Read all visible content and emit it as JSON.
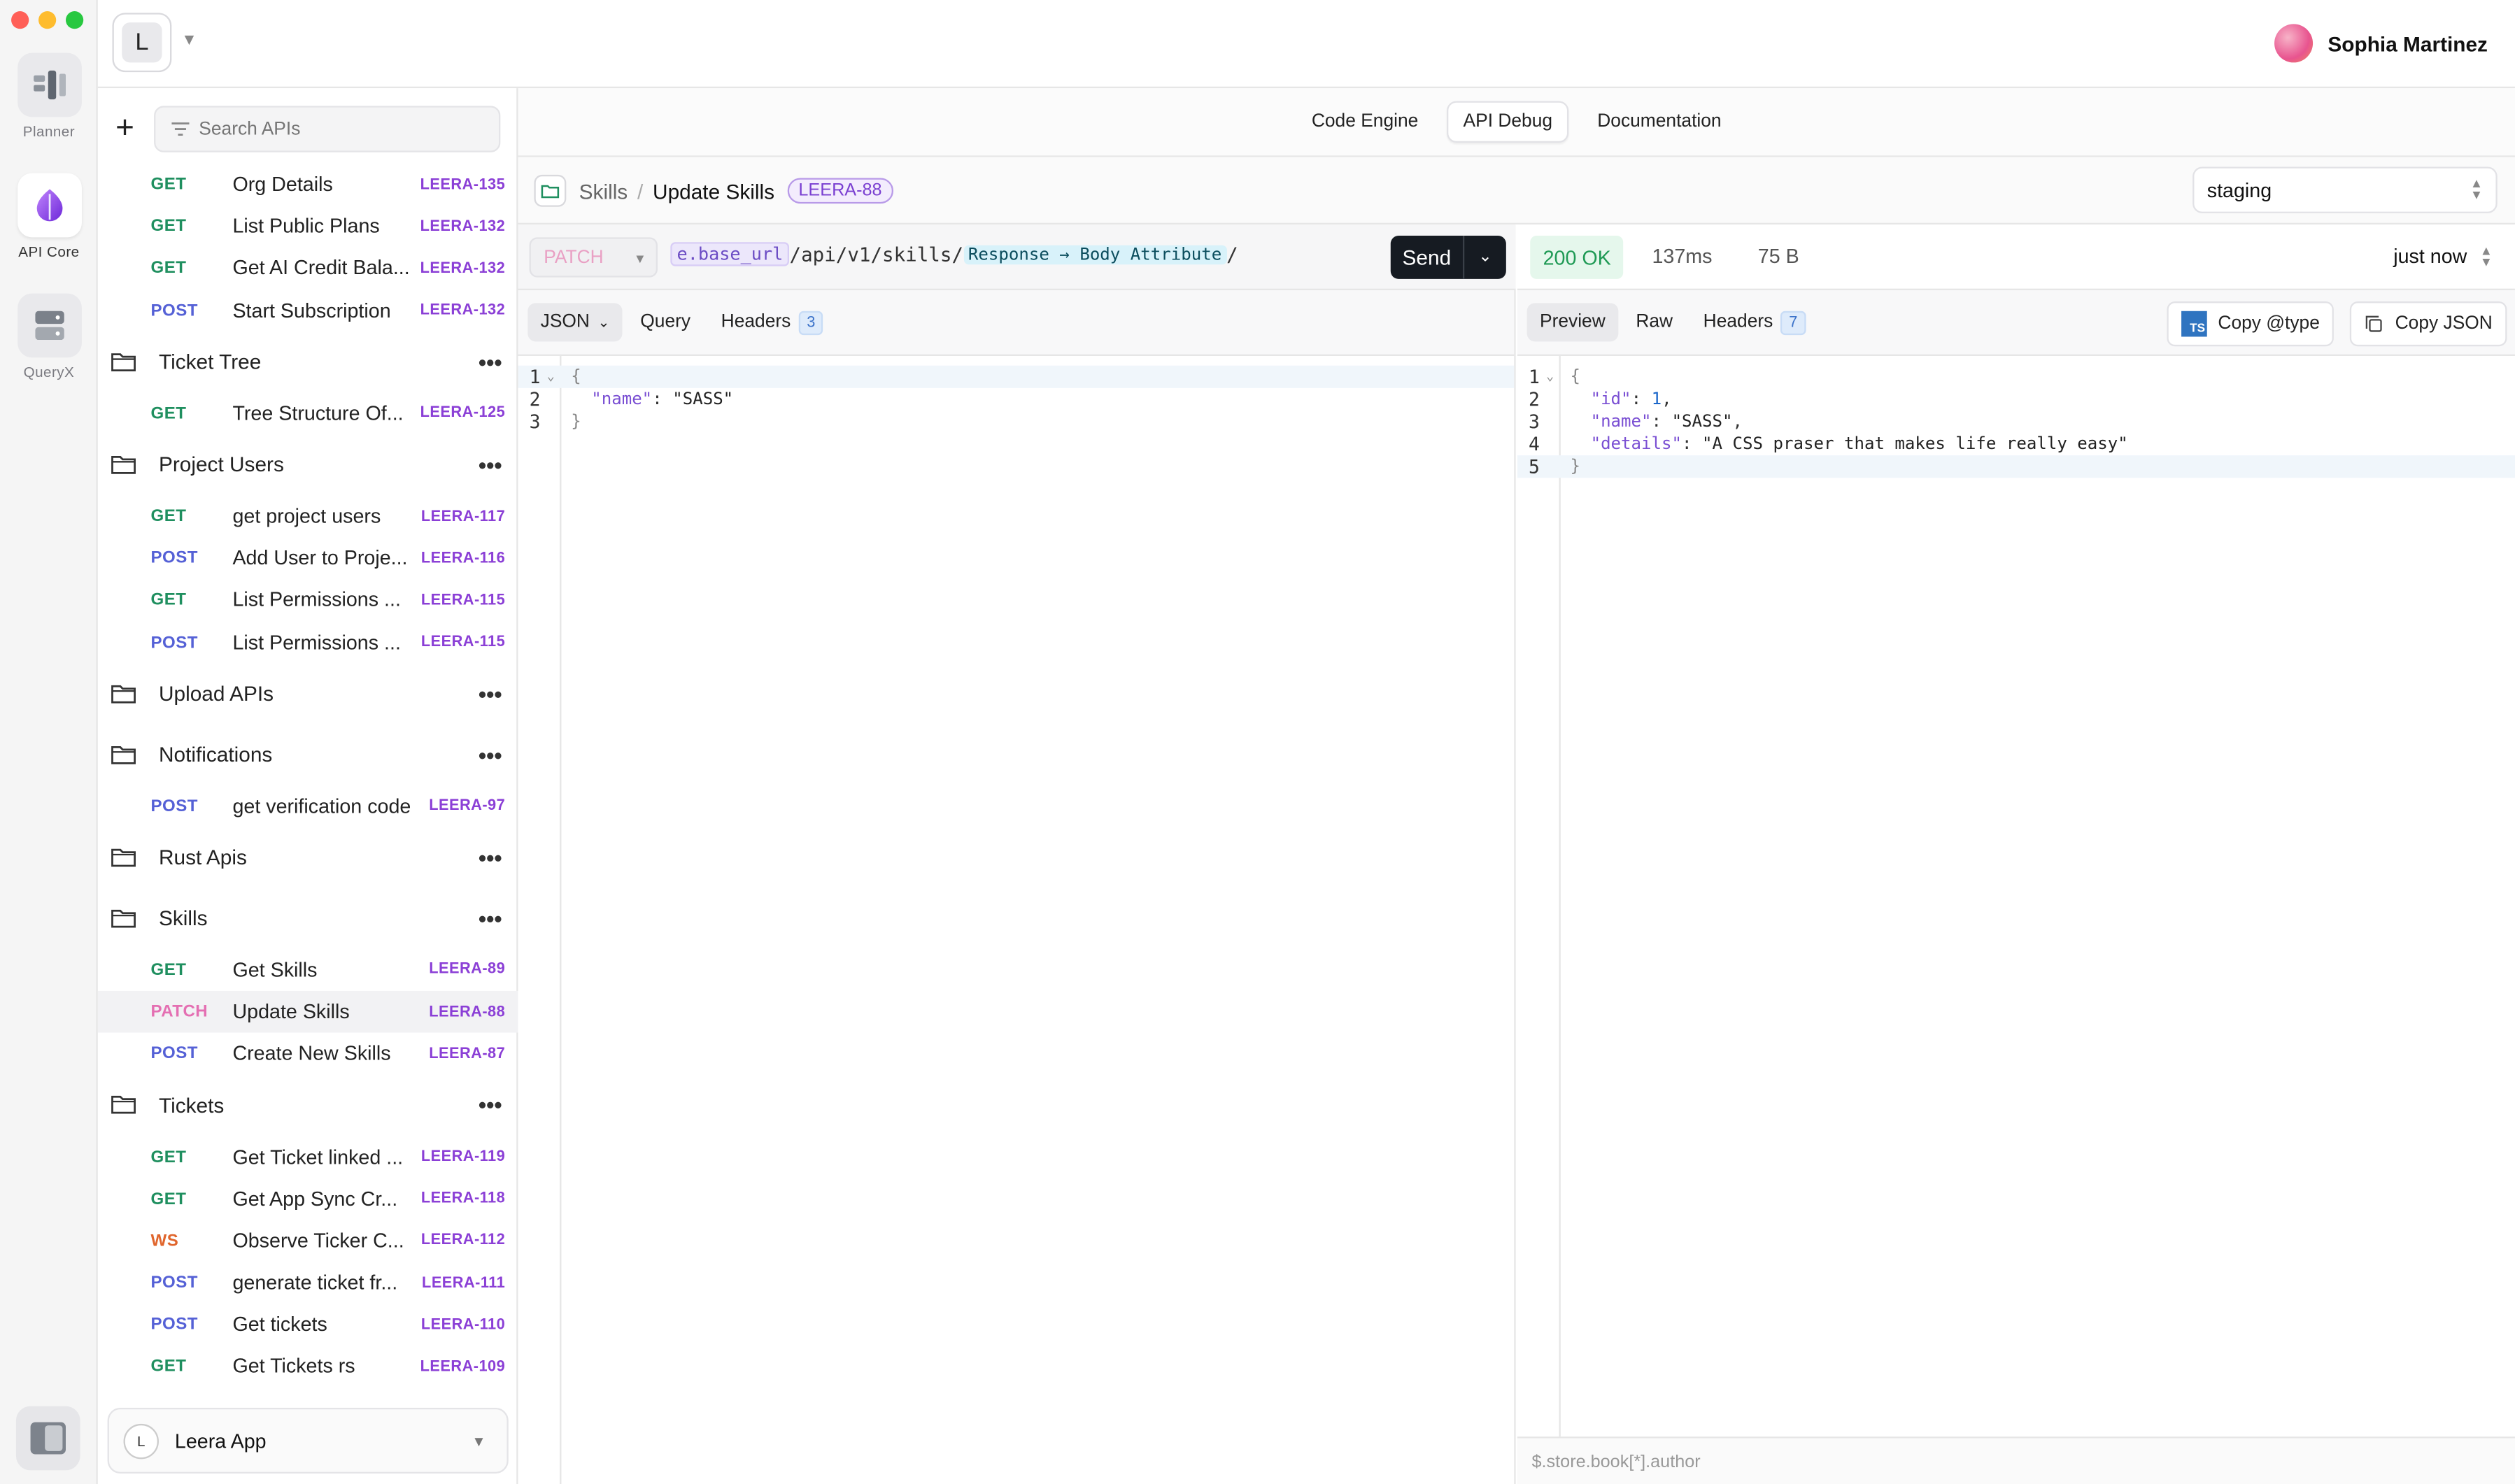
{
  "rail": {
    "items": [
      {
        "label": "Planner",
        "icon": "planner-icon"
      },
      {
        "label": "API Core",
        "icon": "api-core-icon"
      },
      {
        "label": "QueryX",
        "icon": "database-icon"
      }
    ],
    "traffic_colors": [
      "#ff5f57",
      "#febc2e",
      "#28c840"
    ]
  },
  "workspace": {
    "initial": "L"
  },
  "user": {
    "name": "Sophia Martinez"
  },
  "sidebar": {
    "search_placeholder": "Search APIs",
    "ungrouped": [
      {
        "method": "GET",
        "name": "Org Details",
        "id": "LEERA-135"
      },
      {
        "method": "GET",
        "name": "List Public Plans",
        "id": "LEERA-132"
      },
      {
        "method": "GET",
        "name": "Get AI Credit Bala...",
        "id": "LEERA-132"
      },
      {
        "method": "POST",
        "name": "Start Subscription",
        "id": "LEERA-132"
      }
    ],
    "folders": [
      {
        "name": "Ticket Tree",
        "requests": [
          {
            "method": "GET",
            "name": "Tree Structure Of...",
            "id": "LEERA-125"
          }
        ]
      },
      {
        "name": "Project Users",
        "requests": [
          {
            "method": "GET",
            "name": "get project users",
            "id": "LEERA-117"
          },
          {
            "method": "POST",
            "name": "Add User to Proje...",
            "id": "LEERA-116"
          },
          {
            "method": "GET",
            "name": "List Permissions ...",
            "id": "LEERA-115"
          },
          {
            "method": "POST",
            "name": "List Permissions ...",
            "id": "LEERA-115"
          }
        ]
      },
      {
        "name": "Upload APIs",
        "requests": []
      },
      {
        "name": "Notifications",
        "requests": [
          {
            "method": "POST",
            "name": "get verification code",
            "id": "LEERA-97"
          }
        ]
      },
      {
        "name": "Rust Apis",
        "requests": []
      },
      {
        "name": "Skills",
        "requests": [
          {
            "method": "GET",
            "name": "Get Skills",
            "id": "LEERA-89"
          },
          {
            "method": "PATCH",
            "name": "Update Skills",
            "id": "LEERA-88",
            "active": true
          },
          {
            "method": "POST",
            "name": "Create New Skills",
            "id": "LEERA-87"
          }
        ]
      },
      {
        "name": "Tickets",
        "requests": [
          {
            "method": "GET",
            "name": "Get Ticket linked ...",
            "id": "LEERA-119"
          },
          {
            "method": "GET",
            "name": "Get App Sync Cr...",
            "id": "LEERA-118"
          },
          {
            "method": "WS",
            "name": "Observe Ticker C...",
            "id": "LEERA-112"
          },
          {
            "method": "POST",
            "name": "generate ticket fr...",
            "id": "LEERA-111"
          },
          {
            "method": "POST",
            "name": "Get tickets",
            "id": "LEERA-110"
          },
          {
            "method": "GET",
            "name": "Get Tickets rs",
            "id": "LEERA-109"
          }
        ]
      }
    ],
    "method_colors": {
      "GET": "#1f8f5f",
      "POST": "#5561d6",
      "PATCH": "#e46fb2",
      "WS": "#e0652c"
    },
    "app": {
      "initial": "L",
      "name": "Leera App"
    }
  },
  "modes": {
    "tabs": [
      "Code Engine",
      "API Debug",
      "Documentation"
    ],
    "active": "API Debug"
  },
  "breadcrumb": {
    "parent": "Skills",
    "separator": "/",
    "current": "Update Skills",
    "ticket": "LEERA-88"
  },
  "environment": {
    "selected": "staging"
  },
  "request": {
    "method": "PATCH",
    "url_var": "e.base_url",
    "url_path": "/api/v1/skills/",
    "url_ref": "Response → Body Attribute",
    "url_tail": "/",
    "send_label": "Send",
    "tabs": {
      "body_type": "JSON",
      "query": "Query",
      "headers": "Headers",
      "headers_count": "3"
    },
    "body_lines": [
      {
        "n": "1",
        "text": "{"
      },
      {
        "n": "2",
        "key": "\"name\"",
        "value": "\"SASS\""
      },
      {
        "n": "3",
        "text": "}"
      }
    ]
  },
  "response": {
    "status": "200 OK",
    "time": "137ms",
    "size": "75 B",
    "when": "just now",
    "tabs": {
      "preview": "Preview",
      "raw": "Raw",
      "headers": "Headers",
      "headers_count": "7"
    },
    "copy_type_label": "Copy @type",
    "copy_json_label": "Copy JSON",
    "ts_badge": "TS",
    "body_lines": [
      {
        "n": "1",
        "text": "{"
      },
      {
        "n": "2",
        "key": "\"id\"",
        "value": "1",
        "comma": ","
      },
      {
        "n": "3",
        "key": "\"name\"",
        "value": "\"SASS\"",
        "comma": ","
      },
      {
        "n": "4",
        "key": "\"details\"",
        "value": "\"A CSS praser that makes life really easy\""
      },
      {
        "n": "5",
        "text": "}"
      }
    ],
    "jsonpath_placeholder": "$.store.book[*].author"
  }
}
